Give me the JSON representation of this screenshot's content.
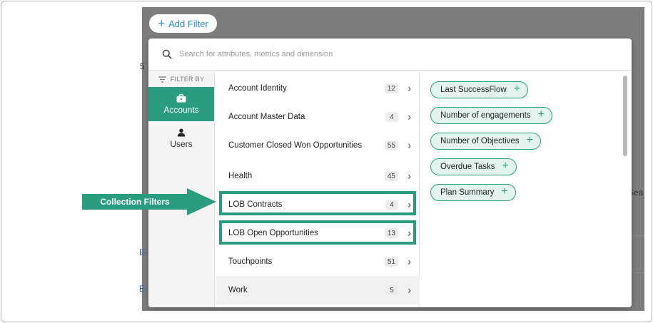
{
  "toolbar": {
    "add_filter_label": "Add Filter"
  },
  "search": {
    "placeholder": "Search for attributes, metrics and dimension"
  },
  "sidebar": {
    "filter_by_label": "FILTER BY",
    "tabs": [
      {
        "label": "Accounts",
        "active": true,
        "icon": "briefcase-icon"
      },
      {
        "label": "Users",
        "active": false,
        "icon": "user-icon"
      }
    ]
  },
  "categories": [
    {
      "label": "Account Identity",
      "count": "12"
    },
    {
      "label": "Account Master Data",
      "count": "4"
    },
    {
      "label": "Customer Closed Won Opportunities",
      "count": "55"
    },
    {
      "label": "Health",
      "count": "45"
    },
    {
      "label": "LOB Contracts",
      "count": "4"
    },
    {
      "label": "LOB Open Opportunities",
      "count": "13"
    },
    {
      "label": "Touchpoints",
      "count": "51"
    },
    {
      "label": "Work",
      "count": "5"
    }
  ],
  "attributes": [
    {
      "label": "Last SuccessFlow"
    },
    {
      "label": "Number of engagements"
    },
    {
      "label": "Number of Objectives"
    },
    {
      "label": "Overdue Tasks"
    },
    {
      "label": "Plan Summary"
    }
  ],
  "annotation": {
    "label": "Collection Filters"
  },
  "background": {
    "fragment_1": "5",
    "fragment_2": "E-",
    "fragment_3": "E-",
    "fragment_4": "Sea"
  },
  "colors": {
    "accent": "#2a9d81",
    "link": "#2a8fcd",
    "overlay": "#7d7d7d"
  }
}
